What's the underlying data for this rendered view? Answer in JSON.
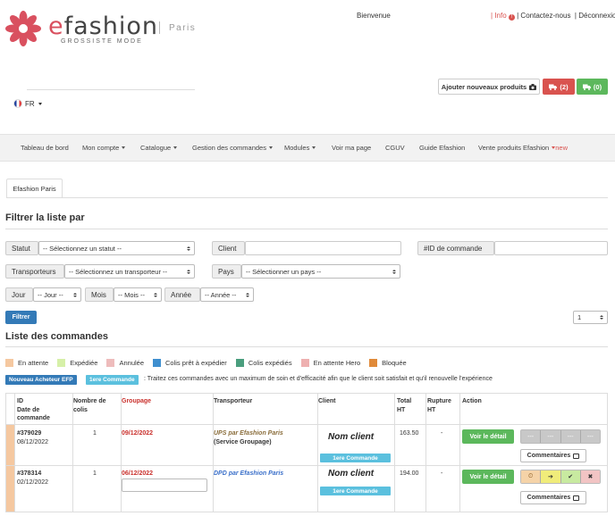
{
  "header": {
    "logo_e": "e",
    "logo_rest": "fashion",
    "city": "Paris",
    "tagline": "GROSSISTE MODE",
    "welcome": "Bienvenue",
    "links": {
      "sep": "|",
      "info": "Info",
      "info_badge": "!",
      "contact": "| Contactez-nous",
      "logout": "| Déconnexion"
    },
    "lang": "FR",
    "add_products": "Ajouter nouveaux produits",
    "cart_red": "(2)",
    "cart_green": "(0)"
  },
  "nav": [
    {
      "label": "Tableau de bord",
      "dropdown": false
    },
    {
      "label": "Mon compte",
      "dropdown": true
    },
    {
      "label": "Catalogue",
      "dropdown": true
    },
    {
      "label": "Gestion des commandes",
      "dropdown": true
    },
    {
      "label": "Modules",
      "dropdown": true
    },
    {
      "label": "Voir ma page",
      "dropdown": false
    },
    {
      "label": "CGUV",
      "dropdown": false
    },
    {
      "label": "Guide Efashion",
      "dropdown": false
    },
    {
      "label": "Vente produits Efashion",
      "dropdown": true,
      "badge": "new"
    }
  ],
  "tab": "Efashion Paris",
  "filter": {
    "title": "Filtrer la liste par",
    "statut_label": "Statut",
    "statut_value": "-- Sélectionnez un statut --",
    "client_label": "Client",
    "order_id_label": "#ID de commande",
    "transport_label": "Transporteurs",
    "transport_value": "-- Sélectionnez un transporteur --",
    "pays_label": "Pays",
    "pays_value": "-- Sélectionner un pays --",
    "jour_label": "Jour",
    "jour_value": "-- Jour --",
    "mois_label": "Mois",
    "mois_value": "-- Mois --",
    "annee_label": "Année",
    "annee_value": "-- Année --",
    "submit": "Filtrer",
    "page": "1"
  },
  "list": {
    "title": "Liste des commandes",
    "legend": [
      {
        "label": "En attente",
        "color": "#f5c8a0"
      },
      {
        "label": "Expédiée",
        "color": "#d6f0a8"
      },
      {
        "label": "Annulée",
        "color": "#eebcbc"
      },
      {
        "label": "Colis prêt à expédier",
        "color": "#3f8fcf"
      },
      {
        "label": "Colis expédiés",
        "color": "#4a9e7e"
      },
      {
        "label": "En attente Hero",
        "color": "#eeb0b0"
      },
      {
        "label": "Bloquée",
        "color": "#e08a3a"
      }
    ],
    "badge_efp": "Nouveau Acheteur EFP",
    "badge_first": "1ere Commande",
    "note": ": Traitez ces commandes avec un maximum de soin et d'efficacité afin que le client soit satisfait et qu'il renouvelle l'expérience",
    "headers": {
      "id": "ID",
      "date": "Date de",
      "date2": "commande",
      "colis": "Nombre de",
      "colis2": "colis",
      "groupage": "Groupage",
      "transporteur": "Transporteur",
      "client": "Client",
      "total": "Total",
      "total2": "HT",
      "rupture": "Rupture",
      "rupture2": "HT",
      "action": "Action"
    },
    "rows": [
      {
        "id": "#379029",
        "date": "08/12/2022",
        "colis": "1",
        "groupage": "09/12/2022",
        "transporteur": "UPS par Efashion Paris",
        "transporteur2": "(Service Groupage)",
        "client": "Nom client",
        "client_badge": "1ere Commande",
        "total": "163.50",
        "rupture": "-",
        "voir": "Voir le détail",
        "actions": [
          "---",
          "---",
          "---",
          "---"
        ],
        "comments": "Commentaires"
      },
      {
        "id": "#378314",
        "date": "02/12/2022",
        "colis": "1",
        "groupage": "06/12/2022",
        "transporteur": "DPD par Efashion Paris",
        "client": "Nom client",
        "client_badge": "1ere Commande",
        "total": "194.00",
        "rupture": "-",
        "voir": "Voir le détail",
        "actions": [
          "⏲",
          "➔",
          "✔",
          "✖"
        ],
        "comments": "Commentaires"
      }
    ]
  }
}
